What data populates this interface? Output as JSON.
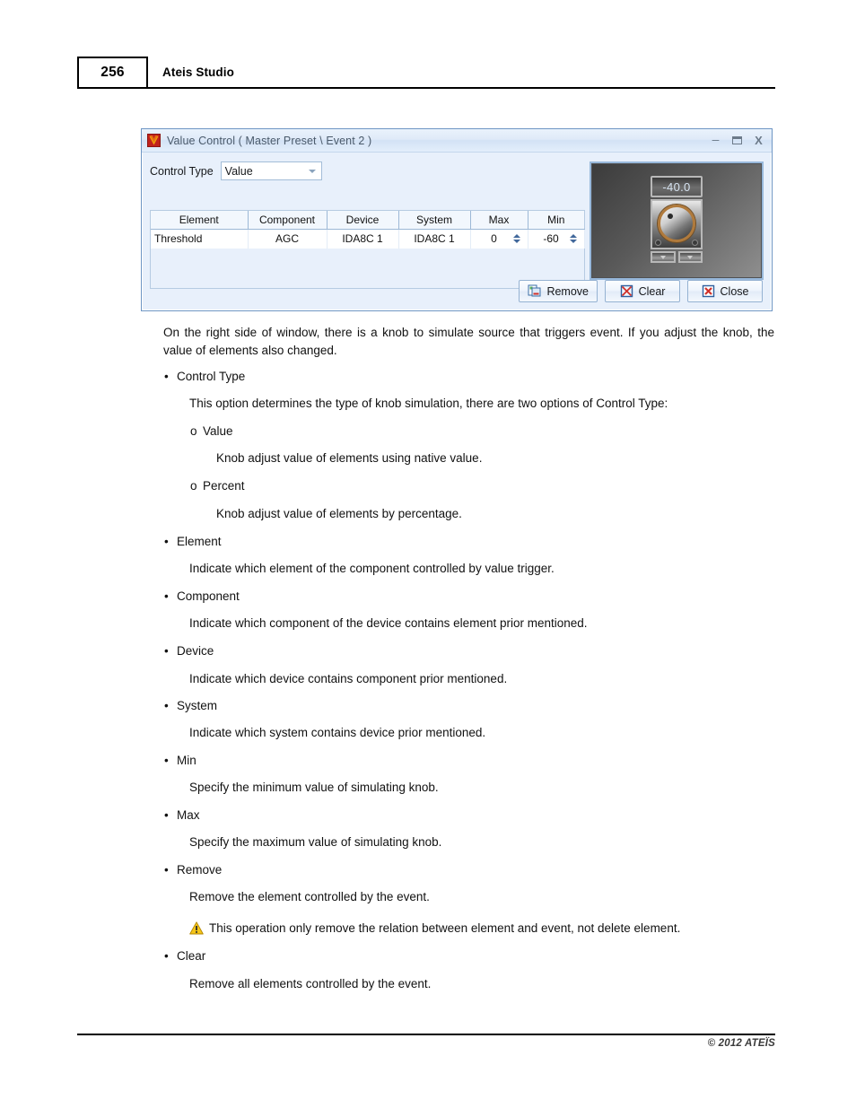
{
  "page": {
    "number": "256",
    "header_title": "Ateis Studio",
    "footer": "© 2012 ATEÏS"
  },
  "dialog": {
    "title": "Value Control ( Master Preset \\ Event 2 )",
    "app_icon": "ateis-logo-icon",
    "window_controls": {
      "minimize": "–",
      "maximize": "□",
      "close": "X"
    },
    "control_type": {
      "label": "Control Type",
      "value": "Value",
      "options": [
        "Value",
        "Percent"
      ]
    },
    "table": {
      "columns": [
        "Element",
        "Component",
        "Device",
        "System",
        "Max",
        "Min"
      ],
      "rows": [
        {
          "element": "Threshold",
          "component": "AGC",
          "device": "IDA8C 1",
          "system": "IDA8C 1",
          "max": "0",
          "min": "-60"
        }
      ]
    },
    "knob": {
      "readout": "-40.0"
    },
    "buttons": [
      {
        "label": "Remove",
        "icon": "remove-item-icon"
      },
      {
        "label": "Clear",
        "icon": "clear-crossed-icon"
      },
      {
        "label": "Close",
        "icon": "close-red-x-icon"
      }
    ]
  },
  "body": {
    "intro": "On the right side of window, there is a knob to simulate source that triggers event. If you adjust the knob, the value of elements also changed.",
    "items": [
      {
        "term": "Control Type",
        "desc": "This option determines the type of knob simulation, there are two options of Control Type:",
        "subitems": [
          {
            "term": "Value",
            "desc": "Knob adjust value of elements using native value."
          },
          {
            "term": "Percent",
            "desc": "Knob adjust value of elements by percentage."
          }
        ]
      },
      {
        "term": "Element",
        "desc": "Indicate which element of the component controlled by value trigger."
      },
      {
        "term": "Component",
        "desc": "Indicate which component of the device contains element prior mentioned."
      },
      {
        "term": "Device",
        "desc": "Indicate which device contains component prior mentioned."
      },
      {
        "term": "System",
        "desc": "Indicate which system contains device prior mentioned."
      },
      {
        "term": "Min",
        "desc": "Specify the minimum value of simulating knob."
      },
      {
        "term": "Max",
        "desc": "Specify the maximum value of simulating knob."
      },
      {
        "term": "Remove",
        "desc": "Remove the element controlled by the event.",
        "note": "This operation only remove the relation between element and event, not delete element."
      },
      {
        "term": "Clear",
        "desc": "Remove all elements controlled by the event."
      }
    ],
    "bullet_mark": "•",
    "sub_bullet_mark": "o"
  }
}
